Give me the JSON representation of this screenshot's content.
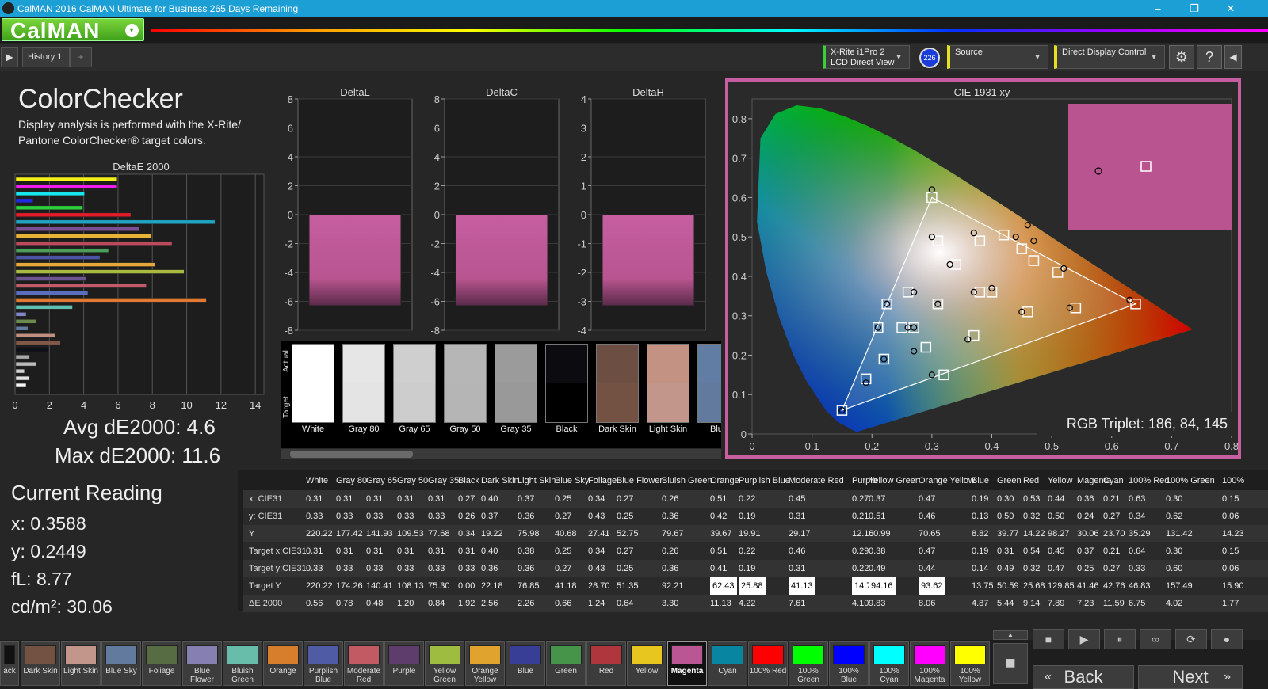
{
  "window": {
    "title": "CalMAN 2016 CalMAN Ultimate for Business 265 Days Remaining",
    "app_icon": "calman-icon",
    "minimize": "–",
    "maximize": "❐",
    "close": "✕"
  },
  "logo": {
    "text": "CalMAN",
    "dropdown": "▾"
  },
  "toolbar": {
    "play": "▶",
    "tab": "History 1",
    "add_tab": "+",
    "meter": {
      "line1": "X-Rite i1Pro 2",
      "line2": "LCD Direct View",
      "badge": "226"
    },
    "source": {
      "label": "Source"
    },
    "display": {
      "label": "Direct Display Control"
    },
    "settings": "⚙",
    "help": "?",
    "collapse": "◀"
  },
  "page": {
    "title": "ColorChecker",
    "desc1": "Display analysis is performed with the X-Rite/",
    "desc2": "Pantone ColorChecker® target colors."
  },
  "colors": {
    "accent": "#c65ea0",
    "measured": "#ba5491",
    "panel_bg": "#262626"
  },
  "deltae_chart": {
    "title": "DeltaE 2000",
    "xticks": [
      "0",
      "2",
      "4",
      "6",
      "8",
      "10",
      "12",
      "14"
    ],
    "xmax": 14.5,
    "bars": [
      {
        "v": 5.9,
        "c": "#f2ee18"
      },
      {
        "v": 5.9,
        "c": "#ee1ced"
      },
      {
        "v": 4.0,
        "c": "#18e6ee"
      },
      {
        "v": 1.0,
        "c": "#1e2ce8"
      },
      {
        "v": 3.9,
        "c": "#2ccf3c"
      },
      {
        "v": 6.7,
        "c": "#e21c2a"
      },
      {
        "v": 11.6,
        "c": "#21a3c2"
      },
      {
        "v": 7.2,
        "c": "#7c4f93"
      },
      {
        "v": 7.9,
        "c": "#e6b336"
      },
      {
        "v": 9.1,
        "c": "#bd4a5c"
      },
      {
        "v": 5.4,
        "c": "#4aa05a"
      },
      {
        "v": 4.9,
        "c": "#4a55a5"
      },
      {
        "v": 8.1,
        "c": "#e6a838"
      },
      {
        "v": 9.8,
        "c": "#aaba40"
      },
      {
        "v": 4.1,
        "c": "#6c5590"
      },
      {
        "v": 7.6,
        "c": "#c25a6a"
      },
      {
        "v": 4.2,
        "c": "#5a6ec0"
      },
      {
        "v": 11.1,
        "c": "#e07a30"
      },
      {
        "v": 3.3,
        "c": "#5ec0b0"
      },
      {
        "v": 0.6,
        "c": "#8085c5"
      },
      {
        "v": 1.2,
        "c": "#6a8a50"
      },
      {
        "v": 0.7,
        "c": "#607aa0"
      },
      {
        "v": 2.3,
        "c": "#c29080"
      },
      {
        "v": 2.6,
        "c": "#805848"
      },
      {
        "v": 1.9,
        "c": "#101018"
      },
      {
        "v": 0.8,
        "c": "#a8a8a8"
      },
      {
        "v": 1.2,
        "c": "#bababa"
      },
      {
        "v": 0.5,
        "c": "#d0d0d0"
      },
      {
        "v": 0.8,
        "c": "#e2e2e2"
      },
      {
        "v": 0.6,
        "c": "#f6f6f6"
      }
    ]
  },
  "avg_label": "Avg dE2000: 4.6",
  "max_label": "Max dE2000: 11.6",
  "reading": {
    "title": "Current Reading",
    "x": "x: 0.3588",
    "y": "y: 0.2449",
    "fl": "fL: 8.77",
    "cd": "cd/m²: 30.06"
  },
  "delta_charts": [
    {
      "title": "DeltaL",
      "ticks": [
        "8",
        "6",
        "4",
        "2",
        "0",
        "-2",
        "-4",
        "-6",
        "-8"
      ],
      "min": -8,
      "max": 8,
      "value": -6.3
    },
    {
      "title": "DeltaC",
      "ticks": [
        "8",
        "6",
        "4",
        "2",
        "0",
        "-2",
        "-4",
        "-6",
        "-8"
      ],
      "min": -8,
      "max": 8,
      "value": -6.3
    },
    {
      "title": "DeltaH",
      "ticks": [
        "4",
        "3",
        "2",
        "1",
        "0",
        "-1",
        "-2",
        "-3",
        "-4"
      ],
      "min": -4,
      "max": 4,
      "value": -3.15
    }
  ],
  "swatch_panel": {
    "actual_label": "Actual",
    "target_label": "Target",
    "swatches": [
      {
        "name": "White",
        "actual": "#ffffff",
        "target": "#ffffff"
      },
      {
        "name": "Gray 80",
        "actual": "#e6e6e6",
        "target": "#e4e4e4"
      },
      {
        "name": "Gray 65",
        "actual": "#cfcfcf",
        "target": "#cdcdcd"
      },
      {
        "name": "Gray 50",
        "actual": "#b6b6b6",
        "target": "#b5b5b5"
      },
      {
        "name": "Gray 35",
        "actual": "#9b9b9b",
        "target": "#999999"
      },
      {
        "name": "Black",
        "actual": "#0b0b10",
        "target": "#000000"
      },
      {
        "name": "Dark Skin",
        "actual": "#6c4e42",
        "target": "#735244"
      },
      {
        "name": "Light Skin",
        "actual": "#c39282",
        "target": "#c2968a"
      },
      {
        "name": "Blue",
        "actual": "#617da3",
        "target": "#627a9d"
      }
    ]
  },
  "cie": {
    "title": "CIE 1931 xy",
    "xticks": [
      "0",
      "0.1",
      "0.2",
      "0.3",
      "0.4",
      "0.5",
      "0.6",
      "0.7",
      "0.8"
    ],
    "yticks": [
      "0",
      "0.1",
      "0.2",
      "0.3",
      "0.4",
      "0.5",
      "0.6",
      "0.7",
      "0.8"
    ],
    "xlim": [
      0,
      0.8
    ],
    "ylim": [
      0,
      0.85
    ],
    "triplet": "RGB Triplet: 186, 84, 145",
    "gamut": [
      [
        0.64,
        0.33
      ],
      [
        0.3,
        0.6
      ],
      [
        0.15,
        0.06
      ]
    ],
    "targets": [
      [
        0.31,
        0.33
      ],
      [
        0.4,
        0.36
      ],
      [
        0.38,
        0.36
      ],
      [
        0.25,
        0.27
      ],
      [
        0.34,
        0.43
      ],
      [
        0.27,
        0.27
      ],
      [
        0.26,
        0.36
      ],
      [
        0.51,
        0.41
      ],
      [
        0.22,
        0.19
      ],
      [
        0.46,
        0.31
      ],
      [
        0.29,
        0.22
      ],
      [
        0.38,
        0.49
      ],
      [
        0.47,
        0.44
      ],
      [
        0.19,
        0.14
      ],
      [
        0.31,
        0.49
      ],
      [
        0.54,
        0.32
      ],
      [
        0.45,
        0.47
      ],
      [
        0.37,
        0.25
      ],
      [
        0.21,
        0.27
      ],
      [
        0.64,
        0.33
      ],
      [
        0.3,
        0.6
      ],
      [
        0.15,
        0.06
      ],
      [
        0.225,
        0.33
      ],
      [
        0.32,
        0.15
      ],
      [
        0.42,
        0.505
      ]
    ],
    "measured": [
      [
        0.31,
        0.33
      ],
      [
        0.4,
        0.37
      ],
      [
        0.37,
        0.36
      ],
      [
        0.27,
        0.27
      ],
      [
        0.33,
        0.43
      ],
      [
        0.26,
        0.27
      ],
      [
        0.27,
        0.36
      ],
      [
        0.52,
        0.42
      ],
      [
        0.22,
        0.19
      ],
      [
        0.45,
        0.31
      ],
      [
        0.27,
        0.21
      ],
      [
        0.37,
        0.51
      ],
      [
        0.46,
        0.53
      ],
      [
        0.19,
        0.13
      ],
      [
        0.3,
        0.5
      ],
      [
        0.53,
        0.32
      ],
      [
        0.44,
        0.5
      ],
      [
        0.36,
        0.24
      ],
      [
        0.21,
        0.27
      ],
      [
        0.63,
        0.34
      ],
      [
        0.3,
        0.62
      ],
      [
        0.15,
        0.06
      ],
      [
        0.225,
        0.33
      ],
      [
        0.3,
        0.15
      ],
      [
        0.47,
        0.49
      ]
    ]
  },
  "table": {
    "columns": [
      "White",
      "Gray 80",
      "Gray 65",
      "Gray 50",
      "Gray 35",
      "Black",
      "Dark Skin",
      "Light Skin",
      "Blue Sky",
      "Foliage",
      "Blue Flower",
      "Bluish Green",
      "Orange",
      "Purplish Blue",
      "Moderate Red",
      "Purple",
      "Yellow Green",
      "Orange Yellow",
      "Blue",
      "Green",
      "Red",
      "Yellow",
      "Magenta",
      "Cyan",
      "100% Red",
      "100% Green",
      "100%"
    ],
    "rows": [
      {
        "label": "x: CIE31",
        "cells": [
          "0.31",
          "0.31",
          "0.31",
          "0.31",
          "0.31",
          "0.27",
          "0.40",
          "0.37",
          "0.25",
          "0.34",
          "0.27",
          "0.26",
          "0.51",
          "0.22",
          "0.45",
          "0.27",
          "0.37",
          "0.47",
          "0.19",
          "0.30",
          "0.53",
          "0.44",
          "0.36",
          "0.21",
          "0.63",
          "0.30",
          "0.15"
        ]
      },
      {
        "label": "y: CIE31",
        "cells": [
          "0.33",
          "0.33",
          "0.33",
          "0.33",
          "0.33",
          "0.26",
          "0.37",
          "0.36",
          "0.27",
          "0.43",
          "0.25",
          "0.36",
          "0.42",
          "0.19",
          "0.31",
          "0.21",
          "0.51",
          "0.46",
          "0.13",
          "0.50",
          "0.32",
          "0.50",
          "0.24",
          "0.27",
          "0.34",
          "0.62",
          "0.06"
        ]
      },
      {
        "label": "Y",
        "cells": [
          "220.22",
          "177.42",
          "141.93",
          "109.53",
          "77.68",
          "0.34",
          "19.22",
          "75.98",
          "40.68",
          "27.41",
          "52.75",
          "79.67",
          "39.67",
          "19.91",
          "29.17",
          "12.10",
          "60.99",
          "70.65",
          "8.82",
          "39.77",
          "14.22",
          "98.27",
          "30.06",
          "23.70",
          "35.29",
          "131.42",
          "14.23"
        ]
      },
      {
        "label": "Target x:CIE31",
        "cells": [
          "0.31",
          "0.31",
          "0.31",
          "0.31",
          "0.31",
          "0.31",
          "0.40",
          "0.38",
          "0.25",
          "0.34",
          "0.27",
          "0.26",
          "0.51",
          "0.22",
          "0.46",
          "0.29",
          "0.38",
          "0.47",
          "0.19",
          "0.31",
          "0.54",
          "0.45",
          "0.37",
          "0.21",
          "0.64",
          "0.30",
          "0.15"
        ]
      },
      {
        "label": "Target y:CIE31",
        "cells": [
          "0.33",
          "0.33",
          "0.33",
          "0.33",
          "0.33",
          "0.33",
          "0.36",
          "0.36",
          "0.27",
          "0.43",
          "0.25",
          "0.36",
          "0.41",
          "0.19",
          "0.31",
          "0.22",
          "0.49",
          "0.44",
          "0.14",
          "0.49",
          "0.32",
          "0.47",
          "0.25",
          "0.27",
          "0.33",
          "0.60",
          "0.06"
        ]
      },
      {
        "label": "Target Y",
        "cells": [
          "220.22",
          "174.26",
          "140.41",
          "108.13",
          "75.30",
          "0.00",
          "22.18",
          "76.85",
          "41.18",
          "28.70",
          "51.35",
          "92.21",
          "62.43",
          "25.88",
          "41.13",
          "14.70",
          "94.16",
          "93.62",
          "13.75",
          "50.59",
          "25.68",
          "129.85",
          "41.46",
          "42.76",
          "46.83",
          "157.49",
          "15.90"
        ]
      },
      {
        "label": "ΔE 2000",
        "cells": [
          "0.56",
          "0.78",
          "0.48",
          "1.20",
          "0.84",
          "1.92",
          "2.56",
          "2.26",
          "0.66",
          "1.24",
          "0.64",
          "3.30",
          "11.13",
          "4.22",
          "7.61",
          "4.10",
          "9.83",
          "8.06",
          "4.87",
          "5.44",
          "9.14",
          "7.89",
          "7.23",
          "11.59",
          "6.75",
          "4.02",
          "1.77"
        ]
      }
    ]
  },
  "patches": [
    {
      "label": "ack",
      "color": "#111111"
    },
    {
      "label": "Dark Skin",
      "color": "#735244"
    },
    {
      "label": "Light Skin",
      "color": "#c2968a"
    },
    {
      "label": "Blue Sky",
      "color": "#627a9d"
    },
    {
      "label": "Foliage",
      "color": "#576c43"
    },
    {
      "label": "Blue Flower",
      "color": "#8580b1"
    },
    {
      "label": "Bluish Green",
      "color": "#67bdaa"
    },
    {
      "label": "Orange",
      "color": "#d67e2c"
    },
    {
      "label": "Purplish Blue",
      "color": "#505ba6"
    },
    {
      "label": "Moderate Red",
      "color": "#c15a63"
    },
    {
      "label": "Purple",
      "color": "#5e3c6c"
    },
    {
      "label": "Yellow Green",
      "color": "#9dbc40"
    },
    {
      "label": "Orange Yellow",
      "color": "#e0a32e"
    },
    {
      "label": "Blue",
      "color": "#383d96"
    },
    {
      "label": "Green",
      "color": "#469449"
    },
    {
      "label": "Red",
      "color": "#af363c"
    },
    {
      "label": "Yellow",
      "color": "#e7c71f"
    },
    {
      "label": "Magenta",
      "color": "#bb5695"
    },
    {
      "label": "Cyan",
      "color": "#0885a1"
    },
    {
      "label": "100% Red",
      "color": "#ff0000"
    },
    {
      "label": "100% Green",
      "color": "#00ff00"
    },
    {
      "label": "100% Blue",
      "color": "#0000ff"
    },
    {
      "label": "100% Cyan",
      "color": "#00ffff"
    },
    {
      "label": "100% Magenta",
      "color": "#ff00ff"
    },
    {
      "label": "100% Yellow",
      "color": "#ffff00"
    }
  ],
  "controls": {
    "back": "Back",
    "next": "Next",
    "stop": "■",
    "play": "▶",
    "loop": "∞",
    "record": "●",
    "pause": "⏸",
    "refresh": "⟳",
    "big_stop": "■"
  }
}
